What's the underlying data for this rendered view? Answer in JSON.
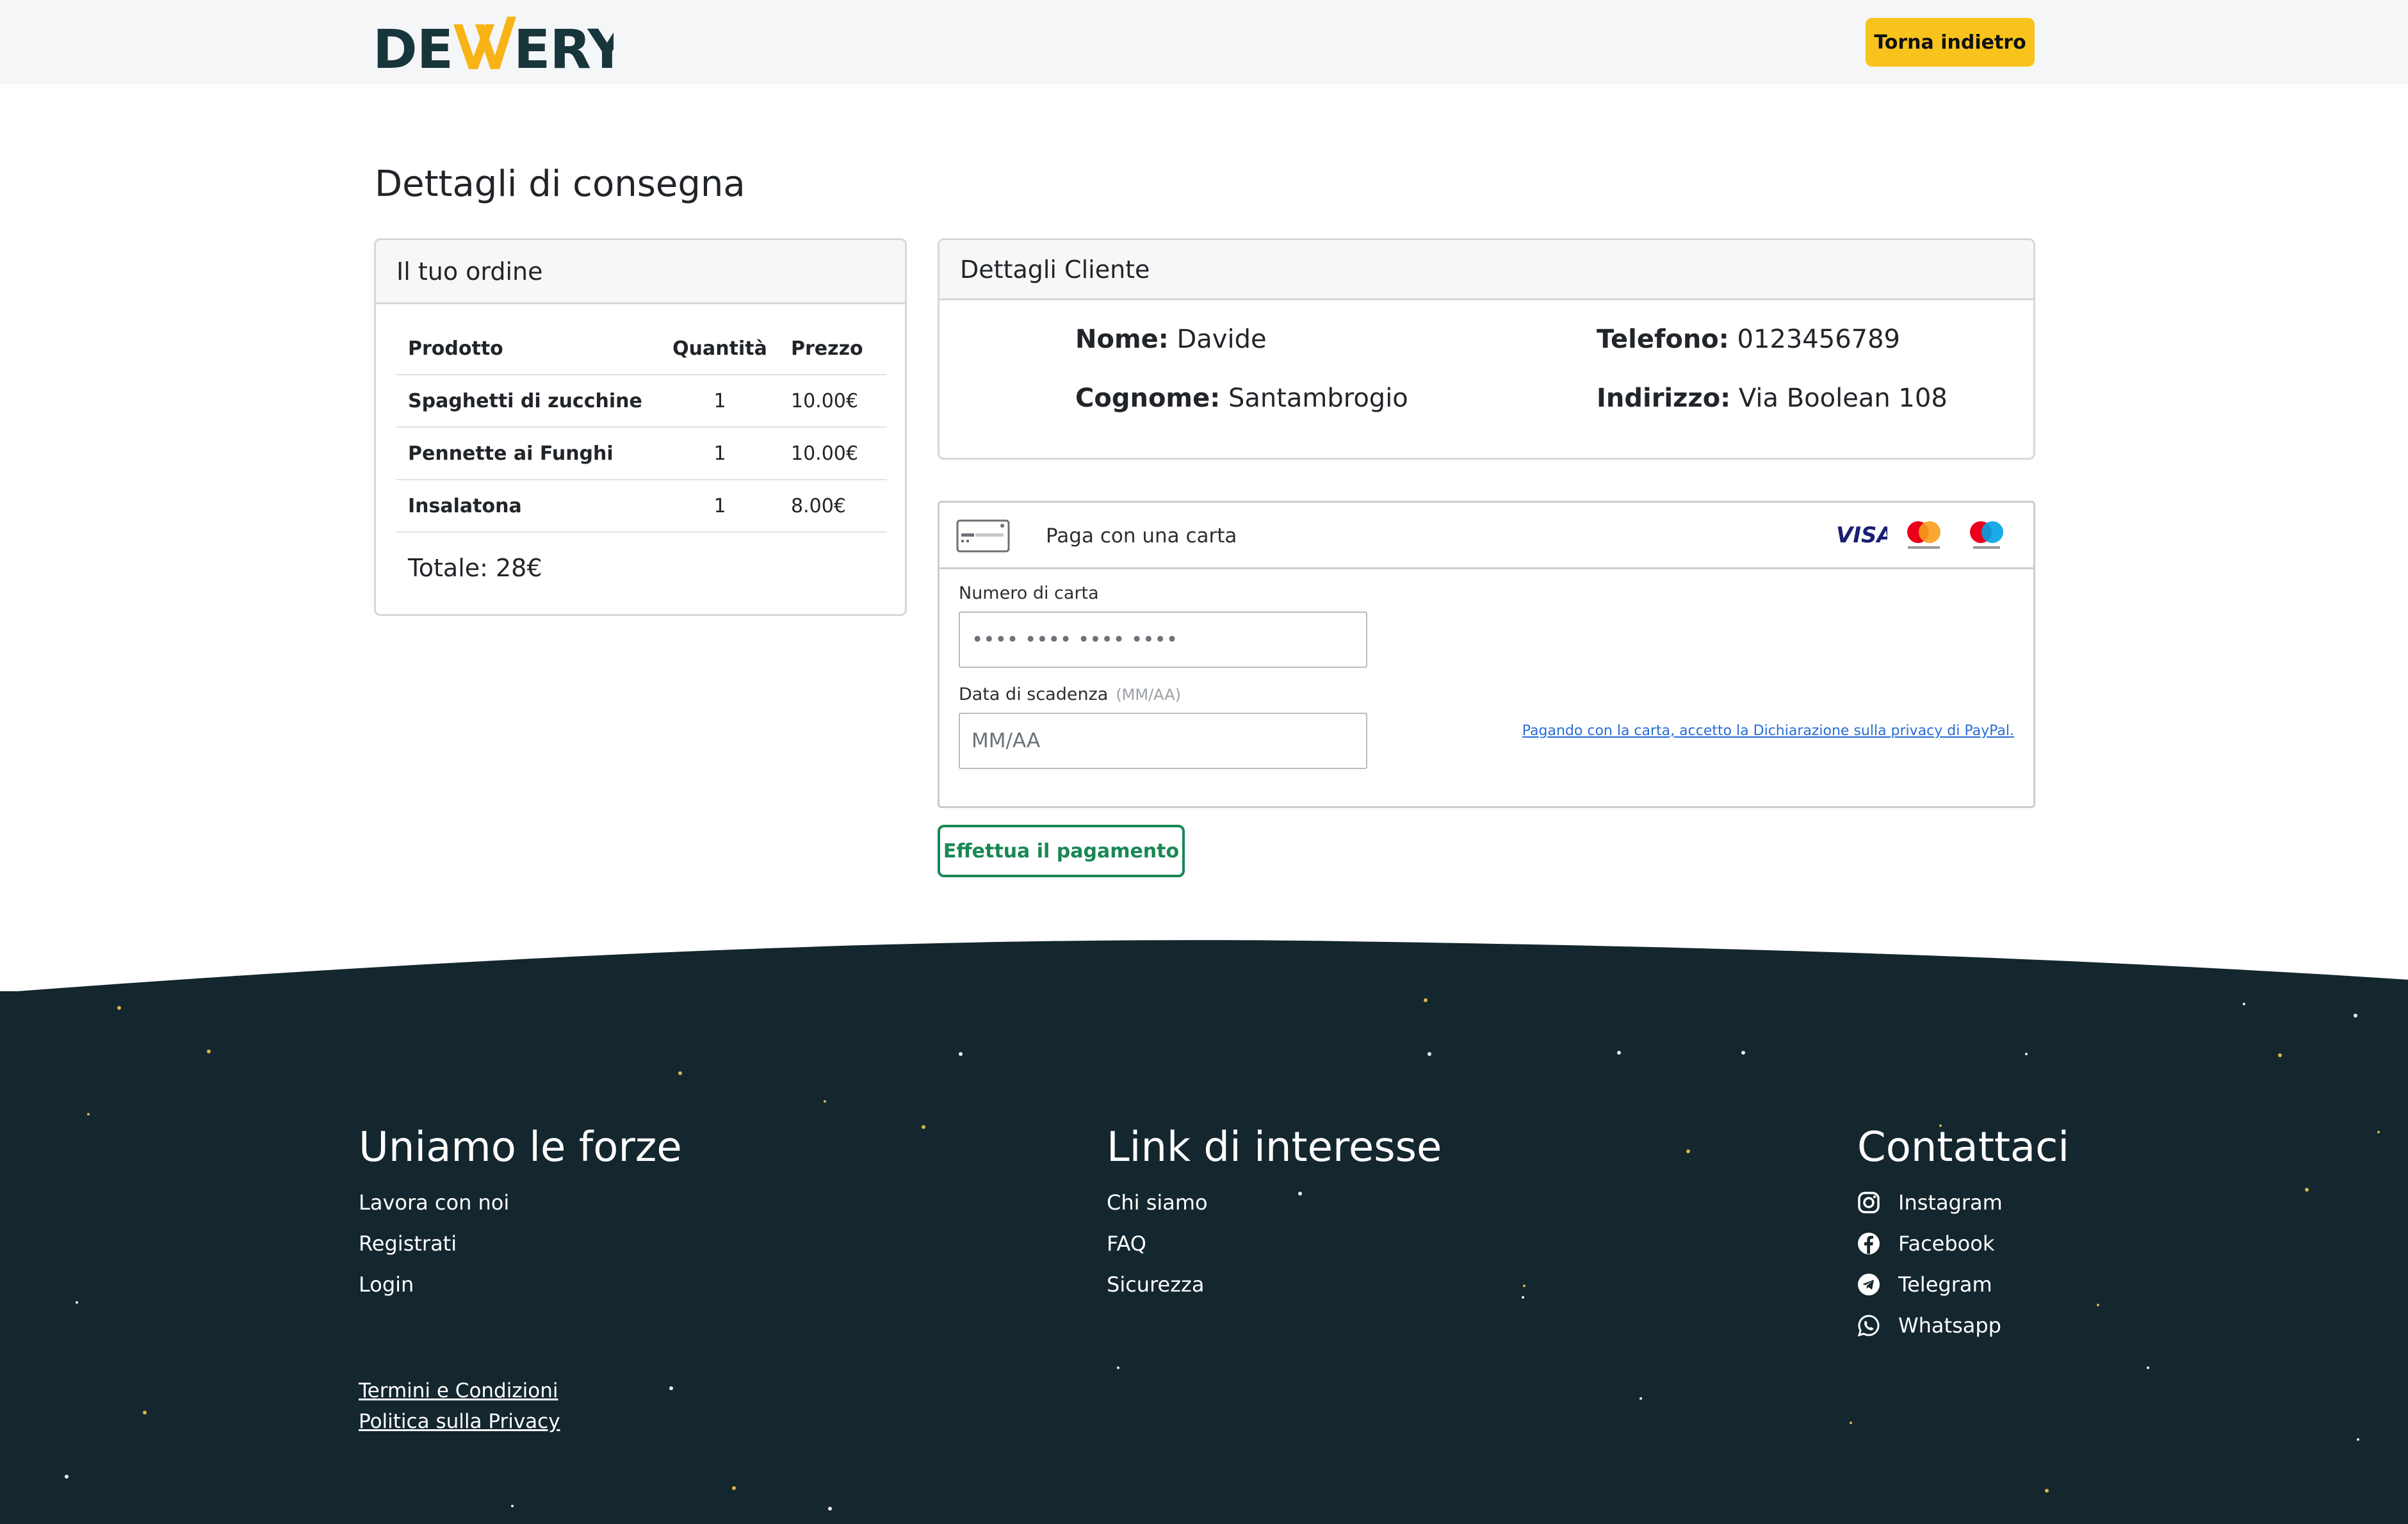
{
  "header": {
    "logo_text": "DEVVERY",
    "logo_accent_color": "#f8b417",
    "logo_dark_color": "#18353c",
    "back_button": "Torna indietro"
  },
  "page_title": "Dettagli di consegna",
  "order": {
    "title": "Il tuo ordine",
    "columns": [
      "Prodotto",
      "Quantità",
      "Prezzo"
    ],
    "rows": [
      {
        "product": "Spaghetti di zucchine",
        "qty": "1",
        "price": "10.00€"
      },
      {
        "product": "Pennette ai Funghi",
        "qty": "1",
        "price": "10.00€"
      },
      {
        "product": "Insalatona",
        "qty": "1",
        "price": "8.00€"
      }
    ],
    "total": "Totale: 28€"
  },
  "customer": {
    "title": "Dettagli Cliente",
    "name_label": "Nome:",
    "name": "Davide",
    "surname_label": "Cognome:",
    "surname": "Santambrogio",
    "phone_label": "Telefono:",
    "phone": "0123456789",
    "address_label": "Indirizzo:",
    "address": "Via Boolean 108"
  },
  "payment": {
    "title": "Paga con una carta",
    "brands": [
      "VISA",
      "mastercard",
      "maestro"
    ],
    "card_number_label": "Numero di carta",
    "card_number_placeholder": "•••• •••• •••• ••••",
    "expiry_label": "Data di scadenza",
    "expiry_hint": "(MM/AA)",
    "expiry_placeholder": "MM/AA",
    "privacy_text": "Pagando con la carta, accetto la Dichiarazione sulla privacy di PayPal.",
    "submit_button": "Effettua il pagamento"
  },
  "footer": {
    "bg_color": "#14262e",
    "col1": {
      "title": "Uniamo le forze",
      "links": [
        "Lavora con noi",
        "Registrati",
        "Login"
      ]
    },
    "col2": {
      "title": "Link di interesse",
      "links": [
        "Chi siamo",
        "FAQ",
        "Sicurezza"
      ]
    },
    "col3": {
      "title": "Contattaci",
      "links": [
        {
          "icon": "instagram-icon",
          "label": "Instagram"
        },
        {
          "icon": "facebook-icon",
          "label": "Facebook"
        },
        {
          "icon": "telegram-icon",
          "label": "Telegram"
        },
        {
          "icon": "whatsapp-icon",
          "label": "Whatsapp"
        }
      ]
    },
    "legal": [
      "Termini e Condizioni",
      "Politica sulla Privacy"
    ]
  }
}
